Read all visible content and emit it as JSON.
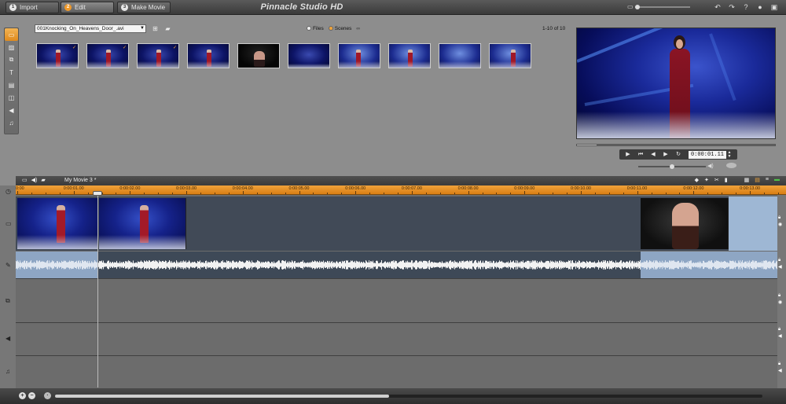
{
  "app": {
    "title": "Pinnacle Studio HD",
    "modes": [
      {
        "num": "1",
        "label": "Import"
      },
      {
        "num": "2",
        "label": "Edit"
      },
      {
        "num": "3",
        "label": "Make Movie"
      }
    ],
    "active_mode": "Edit",
    "top_icons": [
      "monitor-icon",
      "undo-icon",
      "redo-icon",
      "help-icon",
      "lightbulb-icon",
      "camera-icon"
    ]
  },
  "album": {
    "file_select": "001Knocking_On_Heavens_Door_.avi",
    "view_options": [
      "Files",
      "Scenes"
    ],
    "selected_view": "Scenes",
    "page_count": "1-10 of 10",
    "scene_count": 10,
    "tools": [
      "video-scenes-icon",
      "photos-icon",
      "transitions-icon",
      "titles-icon",
      "menus-icon",
      "effects-icon",
      "sound-effects-icon",
      "music-icon"
    ]
  },
  "preview": {
    "timecode": "0:00:01.11",
    "progress": 0.1,
    "volume": 0.5
  },
  "timeline": {
    "project_name": "My Movie 3 *",
    "ruler_labels": [
      "0:00",
      "0:00:01.00",
      "0:00:02.00",
      "0:00:03.00",
      "0:00:04.00",
      "0:00:05.00",
      "0:00:06.00",
      "0:00:07.00",
      "0:00:08.00",
      "0:00:09.00",
      "0:00:10.00",
      "0:00:11.00",
      "0:00:12.00",
      "0:00:13.00"
    ],
    "playhead_time": "0:00:01.11",
    "scroll_position": 0.47
  }
}
